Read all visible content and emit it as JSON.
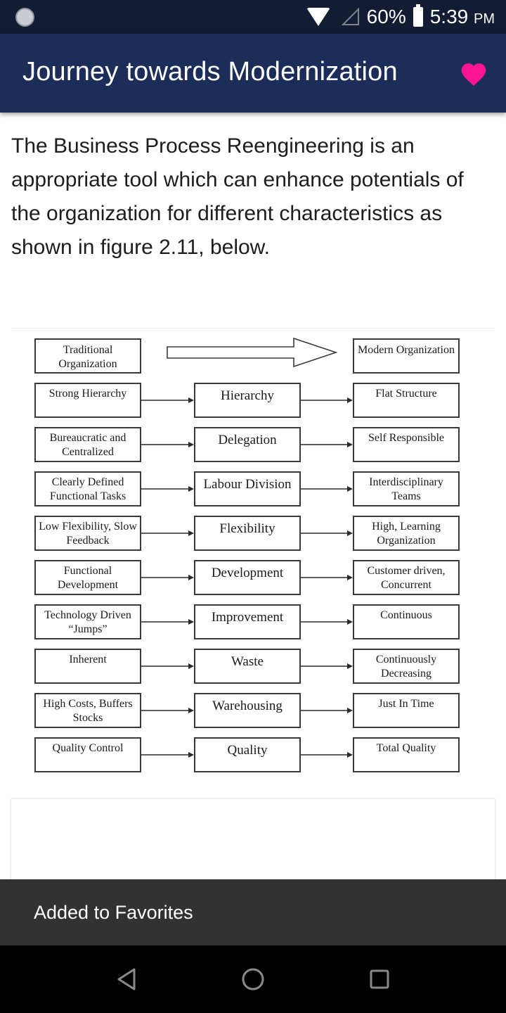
{
  "status_bar": {
    "battery_percent": "60%",
    "time": "5:39",
    "ampm": "PM",
    "icons": [
      "sync-icon",
      "wifi-icon",
      "signal-icon",
      "battery-charging-icon"
    ]
  },
  "app_bar": {
    "title": "Journey towards Modernization",
    "favorite_icon": "heart-icon",
    "favorite_color": "#ff1493"
  },
  "content": {
    "paragraph": "The Business Process Reengineering is an appropriate tool which can enhance potentials of the organization for different characteristics as shown in figure 2.11, below."
  },
  "figure": {
    "header": {
      "left": "Traditional Organization",
      "right": "Modern Organization"
    },
    "rows": [
      {
        "traditional": "Strong Hierarchy",
        "aspect": "Hierarchy",
        "modern": "Flat Structure"
      },
      {
        "traditional": "Bureaucratic and Centralized",
        "aspect": "Delegation",
        "modern": "Self Responsible"
      },
      {
        "traditional": "Clearly Defined Functional Tasks",
        "aspect": "Labour Division",
        "modern": "Interdisciplinary Teams"
      },
      {
        "traditional": "Low Flexibility, Slow Feedback",
        "aspect": "Flexibility",
        "modern": "High, Learning Organization"
      },
      {
        "traditional": "Functional Development",
        "aspect": "Development",
        "modern": "Customer driven, Concurrent"
      },
      {
        "traditional": "Technology Driven “Jumps”",
        "aspect": "Improvement",
        "modern": "Continuous"
      },
      {
        "traditional": "Inherent",
        "aspect": "Waste",
        "modern": "Continuously Decreasing"
      },
      {
        "traditional": "High Costs, Buffers Stocks",
        "aspect": "Warehousing",
        "modern": "Just In Time"
      },
      {
        "traditional": "Quality Control",
        "aspect": "Quality",
        "modern": "Total Quality"
      }
    ]
  },
  "snackbar": {
    "message": "Added to Favorites"
  },
  "nav_bar": {
    "back": "back-icon",
    "home": "home-icon",
    "recents": "recents-icon"
  }
}
